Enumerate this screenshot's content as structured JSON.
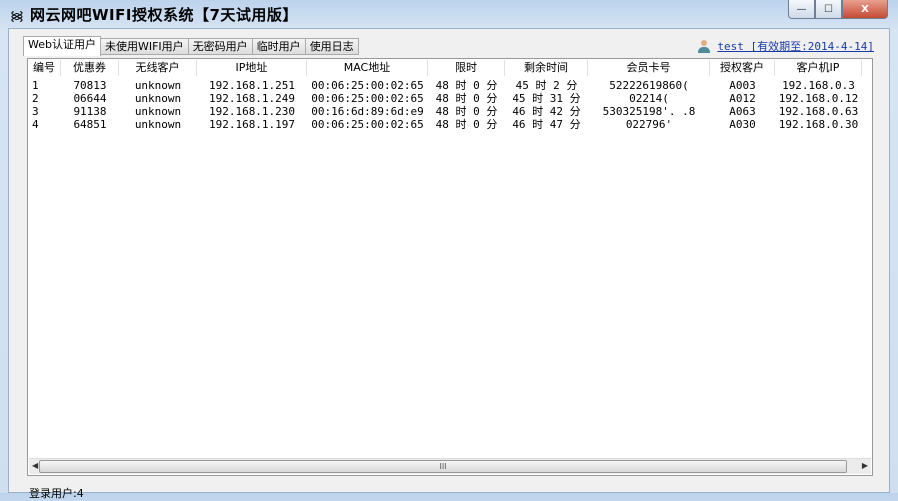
{
  "window": {
    "title": "网云网吧WIFI授权系统【7天试用版】",
    "minimize": "—",
    "maximize": "☐",
    "close": "X"
  },
  "tabs": [
    "Web认证用户",
    "未使用WIFI用户",
    "无密码用户",
    "临时用户",
    "使用日志"
  ],
  "user_link": "test [有效期至:2014-4-14]",
  "table": {
    "columns": [
      "编号",
      "优惠券",
      "无线客户",
      "IP地址",
      "MAC地址",
      "限时",
      "剩余时间",
      "会员卡号",
      "授权客户",
      "客户机IP"
    ],
    "rows": [
      [
        "1",
        "70813",
        "unknown",
        "192.168.1.251",
        "00:06:25:00:02:65",
        "48 时 0 分",
        "45 时 2 分",
        "52222619860(",
        "A003",
        "192.168.0.3"
      ],
      [
        "2",
        "06644",
        "unknown",
        "192.168.1.249",
        "00:06:25:00:02:65",
        "48 时 0 分",
        "45 时 31 分",
        "02214(",
        "A012",
        "192.168.0.12"
      ],
      [
        "3",
        "91138",
        "unknown",
        "192.168.1.230",
        "00:16:6d:89:6d:e9",
        "48 时 0 分",
        "46 时 42 分",
        "530325198'.     .8",
        "A063",
        "192.168.0.63"
      ],
      [
        "4",
        "64851",
        "unknown",
        "192.168.1.197",
        "00:06:25:00:02:65",
        "48 时 0 分",
        "46 时 47 分",
        "022796'",
        "A030",
        "192.168.0.30"
      ]
    ]
  },
  "scroll": {
    "left": "◀",
    "right": "▶",
    "grip": "III"
  },
  "status": "登录用户:4"
}
